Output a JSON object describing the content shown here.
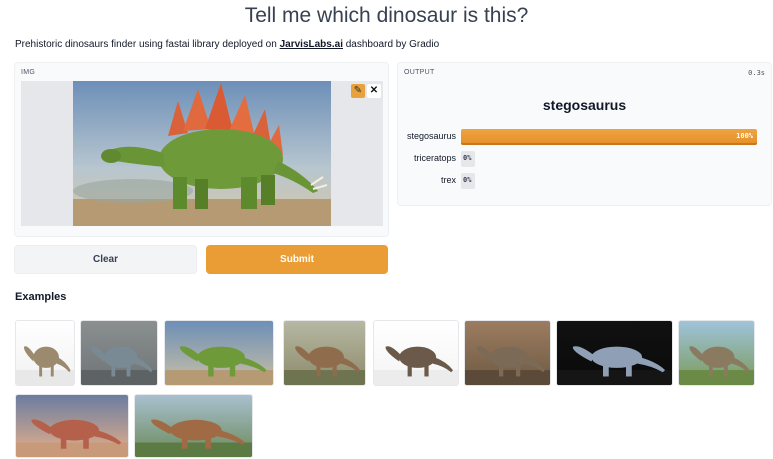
{
  "header": {
    "title": "Tell me which dinosaur is this?",
    "description_prefix": "Prehistoric dinosaurs finder using fastai library deployed on ",
    "description_link": "JarvisLabs.ai",
    "description_suffix": " dashboard by Gradio"
  },
  "input_panel": {
    "label": "IMG",
    "edit_icon": "pencil-icon",
    "close_icon": "close-icon"
  },
  "buttons": {
    "clear_label": "Clear",
    "submit_label": "Submit"
  },
  "output_panel": {
    "label": "OUTPUT",
    "timing": "0.3s",
    "top_label": "stegosaurus",
    "confidences": [
      {
        "name": "stegosaurus",
        "value": 1.0,
        "pct": "100%"
      },
      {
        "name": "triceratops",
        "value": 0.0,
        "pct": "0%"
      },
      {
        "name": "trex",
        "value": 0.0,
        "pct": "0%"
      }
    ]
  },
  "examples": {
    "title": "Examples",
    "items": [
      "brachiosaurus-image",
      "parasaurolophus-image",
      "stegosaurus-image",
      "stegosaurus-forest-image",
      "trex-image",
      "triceratops-image",
      "parasaurolophus-dark-image",
      "brachiosaurus-herd-image",
      "pteranodon-image",
      "trex-forest-image"
    ]
  },
  "colors": {
    "accent": "#eb9d35",
    "panel_bg": "#f9fafb"
  }
}
